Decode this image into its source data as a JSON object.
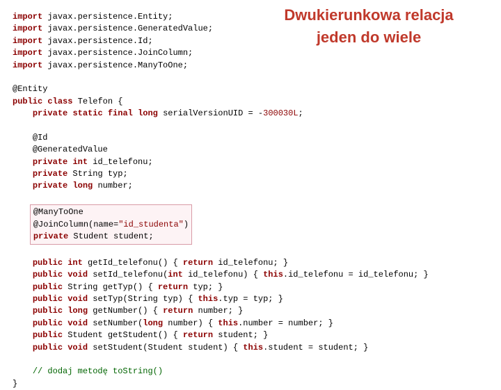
{
  "title_line1": "Dwukierunkowa relacja",
  "title_line2": "jeden do wiele",
  "kw": {
    "import": "import",
    "public": "public",
    "class": "class",
    "private": "private",
    "static": "static",
    "final": "final",
    "long": "long",
    "int": "int",
    "void": "void",
    "return": "return",
    "this": "this"
  },
  "imports": {
    "p0": " javax.persistence.Entity;",
    "p1": " javax.persistence.GeneratedValue;",
    "p2": " javax.persistence.Id;",
    "p3": " javax.persistence.JoinColumn;",
    "p4": " javax.persistence.ManyToOne;"
  },
  "ann": {
    "entity": "@Entity",
    "id": "@Id",
    "gen": "@GeneratedValue",
    "m2o": "@ManyToOne",
    "join_pre": "@JoinColumn(name=",
    "join_str": "\"id_studenta\"",
    "join_post": ")"
  },
  "decl": {
    "class_sig": " Telefon {",
    "suid_pre": " serialVersionUID = -",
    "suid_num": "300030L",
    "suid_post": ";",
    "id_tel": " id_telefonu;",
    "typ": " String typ;",
    "number": " number;",
    "student": " Student student;"
  },
  "methods": {
    "getId_pre": " getId_telefonu() { ",
    "getId_post": " id_telefonu; }",
    "setId_pre": " setId_telefonu(",
    "setId_arg": " id_telefonu) { ",
    "setId_post": ".id_telefonu = id_telefonu; }",
    "getTyp_pre": " String getTyp() { ",
    "getTyp_post": " typ; }",
    "setTyp_pre": " setTyp(String typ) { ",
    "setTyp_post": ".typ = typ; }",
    "getNum_pre": " getNumber() { ",
    "getNum_post": " number; }",
    "setNum_pre": " setNumber(",
    "setNum_arg": " number) { ",
    "setNum_post": ".number = number; }",
    "getStu_pre": " Student getStudent() { ",
    "getStu_post": " student; }",
    "setStu_pre": " setStudent(Student student) { ",
    "setStu_post": ".student = student; }"
  },
  "comment": "// dodaj metodę toString()",
  "close": "}"
}
